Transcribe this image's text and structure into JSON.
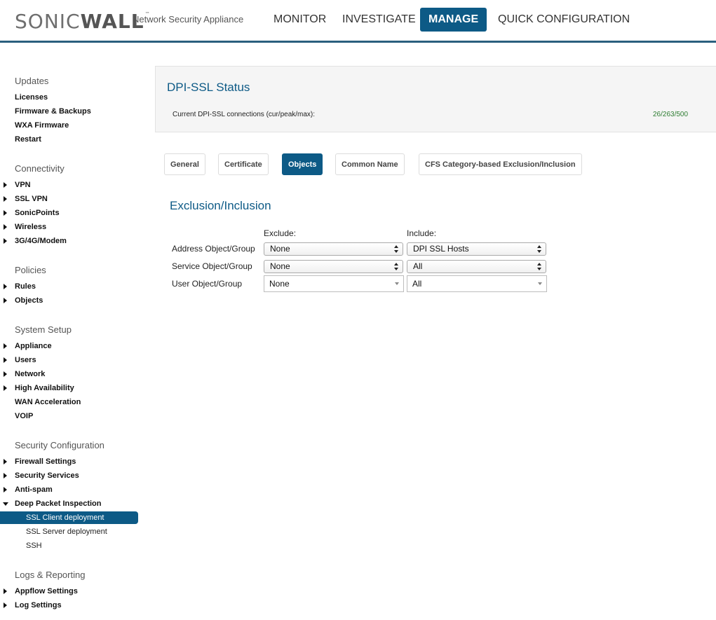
{
  "header": {
    "logo_sonic": "SONIC",
    "logo_wall": "WALL",
    "logo_tm": "™",
    "product": "Network Security Appliance",
    "nav": [
      "MONITOR",
      "INVESTIGATE",
      "MANAGE",
      "QUICK CONFIGURATION"
    ],
    "active_nav": "MANAGE",
    "accent_color": "#0d5a86"
  },
  "sidebar": {
    "groups": [
      {
        "heading": "Updates",
        "items": [
          "Licenses",
          "Firmware & Backups",
          "WXA Firmware",
          "Restart"
        ]
      },
      {
        "heading": "Connectivity",
        "items": [
          "VPN",
          "SSL VPN",
          "SonicPoints",
          "Wireless",
          "3G/4G/Modem"
        ]
      },
      {
        "heading": "Policies",
        "items": [
          "Rules",
          "Objects"
        ]
      },
      {
        "heading": "System Setup",
        "items": [
          "Appliance",
          "Users",
          "Network",
          "High Availability",
          "WAN Acceleration",
          "VOIP"
        ]
      },
      {
        "heading": "Security Configuration",
        "items": [
          "Firewall Settings",
          "Security Services",
          "Anti-spam",
          "Deep Packet Inspection"
        ]
      },
      {
        "heading": "Logs & Reporting",
        "items": [
          "Appflow Settings",
          "Log Settings"
        ]
      }
    ],
    "dpi_subitems": [
      "SSL Client deployment",
      "SSL Server deployment",
      "SSH"
    ],
    "selected": "SSL Client deployment"
  },
  "status": {
    "title": "DPI-SSL Status",
    "label": "Current DPI-SSL connections (cur/peak/max):",
    "value": "26/263/500",
    "value_color": "#2e7d32"
  },
  "tabs": [
    "General",
    "Certificate",
    "Objects",
    "Common Name",
    "CFS Category-based Exclusion/Inclusion"
  ],
  "active_tab": "Objects",
  "section": {
    "title": "Exclusion/Inclusion",
    "exclude_header": "Exclude:",
    "include_header": "Include:",
    "rows": [
      {
        "label": "Address Object/Group",
        "exclude": "None",
        "include": "DPI SSL Hosts"
      },
      {
        "label": "Service Object/Group",
        "exclude": "None",
        "include": "All"
      },
      {
        "label": "User Object/Group",
        "exclude": "None",
        "include": "All"
      }
    ]
  }
}
